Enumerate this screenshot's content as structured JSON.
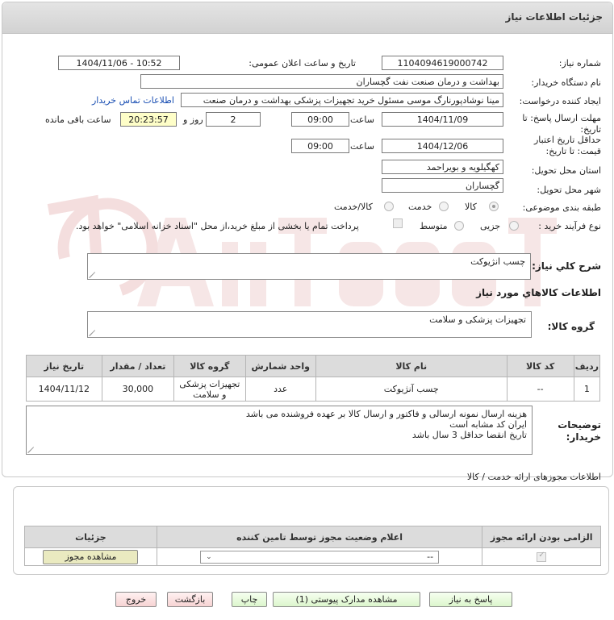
{
  "panel_title": "جزئیات اطلاعات نیاز",
  "fields": {
    "need_number_label": "شماره نیاز:",
    "need_number": "1104094619000742",
    "announce_label": "تاریخ و ساعت اعلان عمومی:",
    "announce_value": "1404/11/06 - 10:52",
    "buyer_org_label": "نام دستگاه خریدار:",
    "buyer_org": "بهداشت و درمان صنعت نفت گچساران",
    "creator_label": "ایجاد کننده درخواست:",
    "creator": "مینا نوشادپورنارگ موسی مسئول خرید تجهیزات پزشکی  بهداشت و درمان صنعت",
    "contact_link": "اطلاعات تماس خریدار",
    "reply_deadline_label_1": "مهلت ارسال پاسخ: تا",
    "reply_deadline_label_2": "تاریخ:",
    "reply_date": "1404/11/09",
    "time_label": "ساعت",
    "reply_time": "09:00",
    "days_count": "2",
    "days_label": "روز و",
    "remaining_time": "20:23:57",
    "remaining_label": "ساعت باقی مانده",
    "validity_label_1": "حداقل تاریخ اعتبار",
    "validity_label_2": "قیمت: تا تاریخ:",
    "validity_date": "1404/12/06",
    "validity_time": "09:00",
    "province_label": "استان محل تحویل:",
    "province": "کهگیلویه و بویراحمد",
    "city_label": "شهر محل تحویل:",
    "city": "گچساران",
    "category_label": "طبقه بندی موضوعی:",
    "category_options": [
      "کالا",
      "خدمت",
      "کالا/خدمت"
    ],
    "process_label": "نوع فرآیند خرید :",
    "process_options": [
      "جزیی",
      "متوسط"
    ],
    "payment_note": "پرداخت تمام یا بخشی از مبلغ خرید،از محل \"اسناد خزانه اسلامی\" خواهد بود."
  },
  "summary": {
    "label": "شرح کلي نياز:",
    "value": "چسب انژیوکت"
  },
  "goods_info_title": "اطلاعات کالاهاي مورد نياز",
  "goods_group": {
    "label": "گروه کالا:",
    "value": "تجهیزات پزشکی و سلامت"
  },
  "items_table": {
    "headers": [
      "ردیف",
      "کد کالا",
      "نام کالا",
      "واحد شمارش",
      "گروه کالا",
      "تعداد / مقدار",
      "تاریخ نیاز"
    ],
    "rows": [
      [
        "1",
        "--",
        "چسب آنژیوکت",
        "عدد",
        "تجهیزات پزشکی و سلامت",
        "30,000",
        "1404/11/12"
      ]
    ]
  },
  "buyer_notes": {
    "label_1": "توضیحات",
    "label_2": "خریدار:",
    "lines": [
      "هزینه ارسال نمونه ارسالی و فاکتور و ارسال کالا بر عهده فروشنده می باشد",
      "ایران کد مشابه است",
      "تاریخ انقضا حداقل 3 سال باشد"
    ]
  },
  "permits": {
    "title": "اطلاعات مجوزهای ارائه خدمت / کالا",
    "headers": [
      "الزامی بودن ارائه مجوز",
      "اعلام وضعیت مجوز توسط تامین کننده",
      "جزئیات"
    ],
    "select_value": "--",
    "view_button": "مشاهده مجوز"
  },
  "buttons": {
    "reply": "پاسخ به نیاز",
    "view_docs": "مشاهده مدارک پیوستی (1)",
    "print": "چاپ",
    "back": "بازگشت",
    "exit": "خروج"
  },
  "colors": {
    "header_bg": "#d8d8d8",
    "yellow_field": "#fefec8",
    "green_button": "#dcf6cc",
    "pink_button": "#f7d3d3",
    "link": "#1a4fb3"
  }
}
